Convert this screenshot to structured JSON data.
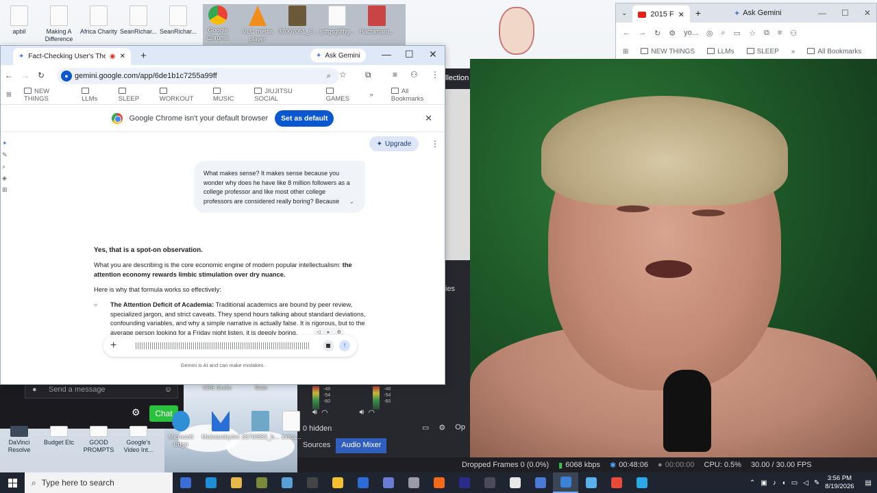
{
  "desktop": {
    "icons_top": [
      {
        "label": "apbil",
        "type": "doc"
      },
      {
        "label": "Making A Difference",
        "type": "doc"
      },
      {
        "label": "Africa Charity",
        "type": "doc"
      },
      {
        "label": "SeanRichar...",
        "type": "doc"
      },
      {
        "label": "SeanRichar...",
        "type": "doc"
      }
    ],
    "icons_thumb": [
      {
        "label": "Google Chrome",
        "color": "#3b82d6"
      },
      {
        "label": "VLC media player",
        "color": "#f28c1a"
      },
      {
        "label": "37007051_6...",
        "color": "#6b5a3a"
      },
      {
        "label": "sdfgsgdfhg...",
        "color": "#e8e8e8"
      },
      {
        "label": "Hachimaru...",
        "color": "#c94444"
      }
    ],
    "icons_bottom": [
      {
        "label": "DaVinci Resolve",
        "color": "#3c4a5c"
      },
      {
        "label": "Budget Etc",
        "color": "#f5f5f5"
      },
      {
        "label": "GOOD PROMPTS",
        "color": "#f5f5f5"
      },
      {
        "label": "Google's Video Int...",
        "color": "#f5f5f5"
      },
      {
        "label": "Microsoft Edge",
        "color": "#2f8fd6"
      },
      {
        "label": "Malwarebytes",
        "color": "#2a6fd6"
      },
      {
        "label": "3676f883_b...",
        "color": "#6fa7c8"
      },
      {
        "label": "todos...",
        "color": "#f5f5f5"
      }
    ],
    "obs_labels": [
      "OBS Studio",
      "Stats"
    ]
  },
  "chrome_main": {
    "tab_title": "Fact-Checking User's Theor",
    "ask_gemini": "Ask Gemini",
    "url": "gemini.google.com/app/6de1b1c7255a99ff",
    "bookmarks": [
      "NEW THINGS",
      "LLMs",
      "SLEEP",
      "WORKOUT",
      "MUSIC",
      "JIUJITSU SOCIAL",
      "GAMES"
    ],
    "all_bookmarks": "All Bookmarks",
    "infobar_text": "Google Chrome isn't your default browser",
    "infobar_button": "Set as default"
  },
  "gemini": {
    "upgrade_label": "Upgrade",
    "user_message": "What makes sense? It makes sense because you wonder why does he have like 8 million followers as a college professor and like most other college professors are considered really boring? Because",
    "response_heading": "Yes, that is a spot-on observation.",
    "response_p1_normal": "What you are describing is the core economic engine of modern popular intellectualism: ",
    "response_p1_bold": "the attention economy rewards limbic stimulation over dry nuance.",
    "response_p2": "Here is why that formula works so effectively:",
    "bullet_title": "The Attention Deficit of Academia:",
    "bullet_text": " Traditional academics are bound by peer review, specialized jargon, and strict caveats. They spend hours talking about standard deviations, confounding variables, and why a simple narrative is actually false. It is rigorous, but to the average person looking for a Friday night listen, it is deeply boring.",
    "disclaimer": "Gemini is AI and can make mistakes."
  },
  "chrome_second": {
    "tab_title": "2015 F",
    "ask_gemini": "Ask Gemini",
    "url_short": "yo...",
    "bookmarks": [
      "NEW THINGS",
      "LLMs",
      "SLEEP"
    ],
    "all_bookmarks": "All Bookmarks"
  },
  "obs": {
    "side_label": "llection",
    "side_label2": "ies",
    "meter_ticks": [
      "-48",
      "-54",
      "-60"
    ],
    "hidden_count": "0 hidden",
    "op_label": "Op",
    "tabs": [
      "Sources",
      "Audio Mixer"
    ],
    "dropped_frames": "Dropped Frames 0 (0.0%)",
    "bitrate": "6068 kbps",
    "stream_time": "00:48:06",
    "rec_time": "00:00:00",
    "cpu": "CPU: 0.5%",
    "fps": "30.00 / 30.00 FPS"
  },
  "chat": {
    "placeholder": "Send a message",
    "chat_button": "Chat"
  },
  "taskbar": {
    "search_placeholder": "Type here to search",
    "time": "3:56 PM",
    "date": "8/19/2026",
    "pinned_colors": [
      "#3b6fd6",
      "#1e8fd6",
      "#e8b84a",
      "#7a8a3a",
      "#5aa0d6",
      "#444",
      "#f2c030",
      "#2f6bd6",
      "#6a7bd6",
      "#9a9aa8",
      "#f26a1a",
      "#2a2a8a",
      "#4a4a5a",
      "#e8e8e8",
      "#4a7ad6",
      "#3b82d6",
      "#5ab0e8",
      "#e84a3a",
      "#2aa8e8"
    ]
  }
}
